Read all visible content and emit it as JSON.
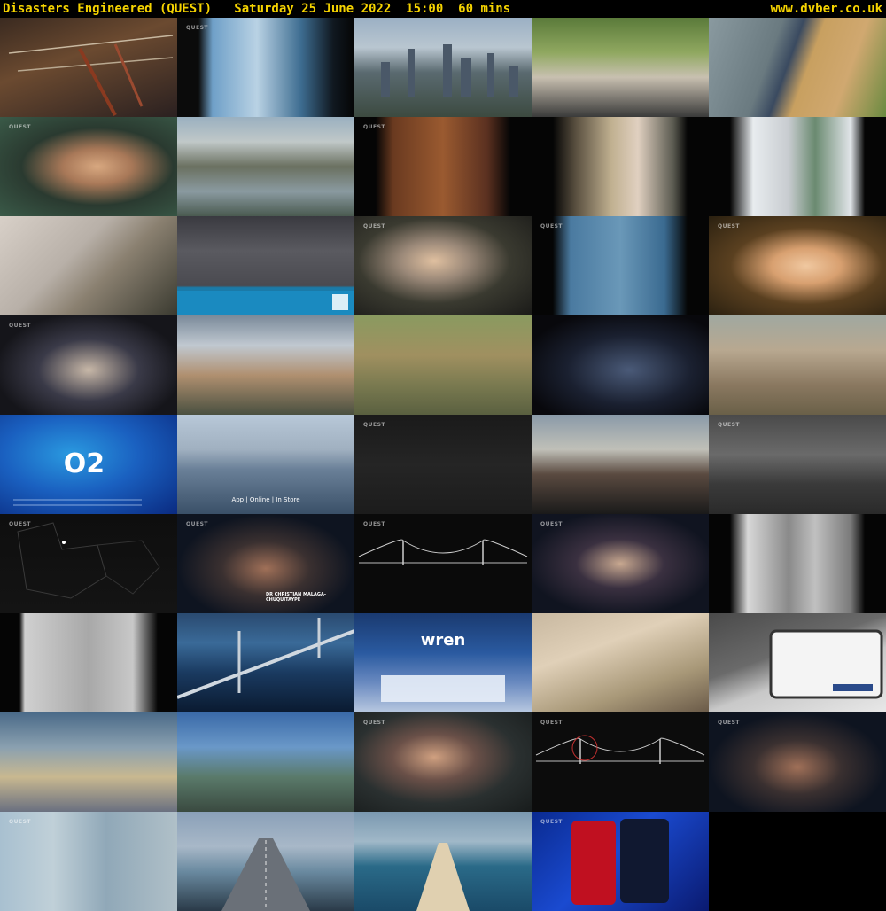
{
  "header": {
    "title": "Disasters Engineered (QUEST)   Saturday 25 June 2022  15:00  60 mins",
    "site": "www.dvber.co.uk"
  },
  "colors": {
    "header_text": "#f5d300",
    "background": "#000000"
  },
  "thumbnails": [
    {
      "id": 1,
      "label": "",
      "watermark": "",
      "bg": "linear-gradient(160deg,#3a2a20 0%,#6b4a30 40%,#2a2020 100%)",
      "overlay": "rods"
    },
    {
      "id": 2,
      "label": "",
      "watermark": "QUEST",
      "bg": "linear-gradient(90deg,#0b0b0b 0%,#0b0b0b 12%,#6fa0c8 20%,#b9d2e4 45%,#3d6c90 70%,#101820 88%,#050505 100%)"
    },
    {
      "id": 3,
      "label": "",
      "watermark": "",
      "bg": "linear-gradient(180deg,#9bb0c4 0%,#b9c6d0 30%,#5a6a70 55%,#3c4a40 100%)",
      "overlay": "city"
    },
    {
      "id": 4,
      "label": "",
      "watermark": "",
      "bg": "linear-gradient(180deg,#5a7a3a 0%,#90a860 35%,#c8c0b0 60%,#3a3a3a 100%)"
    },
    {
      "id": 5,
      "label": "",
      "watermark": "",
      "bg": "linear-gradient(110deg,#8a9aa0 0%,#6a7a80 35%,#3a4a60 45%,#c8a060 55%,#d0a870 75%,#6a8a40 100%)"
    },
    {
      "id": 6,
      "label": "",
      "watermark": "QUEST",
      "bg": "radial-gradient(ellipse at 55% 50%,#d8a880 0%,#a87858 25%,#2a3a30 55%,#3a5a48 100%)"
    },
    {
      "id": 7,
      "label": "",
      "watermark": "",
      "bg": "linear-gradient(180deg,#9ab0c0 0%,#c0c8c8 25%,#6a7060 50%,#8a9aa0 75%,#4a5a50 100%)"
    },
    {
      "id": 8,
      "label": "",
      "watermark": "QUEST",
      "bg": "linear-gradient(90deg,#050505 0%,#050505 12%,#6a3a20 22%,#9a5a30 50%,#5a3020 75%,#050505 88%,#050505 100%)"
    },
    {
      "id": 9,
      "label": "",
      "watermark": "",
      "bg": "linear-gradient(90deg,#050505 0%,#050505 12%,#5a5040 25%,#c0b090 45%,#e0d0c0 60%,#5a5a50 80%,#050505 88%)"
    },
    {
      "id": 10,
      "label": "",
      "watermark": "",
      "bg": "linear-gradient(90deg,#050505 0%,#050505 12%,#e8ecef 25%,#c8ccd0 45%,#6a8a70 60%,#e0e4e8 80%,#050505 88%)"
    },
    {
      "id": 11,
      "label": "",
      "watermark": "",
      "bg": "linear-gradient(135deg,#d8d0c8 0%,#b8b0a8 40%,#8a8070 60%,#3a3a30 100%)"
    },
    {
      "id": 12,
      "label": "",
      "watermark": "",
      "bg": "linear-gradient(180deg,#3a3a40 0%,#5a5a60 35%,#4a4a50 70%,#1a7aa8 72%,#1a7aa8 100%)",
      "overlay": "banner"
    },
    {
      "id": 13,
      "label": "",
      "watermark": "QUEST",
      "bg": "radial-gradient(ellipse at 45% 45%,#e0c0a0 0%,#9a8878 25%,#3a3a30 55%,#1a1a18 100%)"
    },
    {
      "id": 14,
      "label": "",
      "watermark": "QUEST",
      "bg": "linear-gradient(90deg,#050505 0%,#050505 12%,#4a7aa0 22%,#6a98b8 50%,#3a6a90 75%,#050505 88%,#050505 100%)"
    },
    {
      "id": 15,
      "label": "",
      "watermark": "QUEST",
      "bg": "radial-gradient(ellipse at 55% 50%,#f0c8a0 0%,#d8a070 25%,#5a4020 55%,#2a2010 100%)"
    },
    {
      "id": 16,
      "label": "",
      "watermark": "QUEST",
      "bg": "radial-gradient(ellipse at 50% 55%,#c8b8a8 0%,#3a3a48 40%,#15151a 75%)"
    },
    {
      "id": 17,
      "label": "",
      "watermark": "",
      "bg": "linear-gradient(180deg,#7a8a9a 0%,#c0c8d0 30%,#b09070 60%,#4a5040 100%)"
    },
    {
      "id": 18,
      "label": "",
      "watermark": "",
      "bg": "linear-gradient(180deg,#8a9a60 0%,#a09060 40%,#7a7a50 70%,#5a6040 100%)"
    },
    {
      "id": 19,
      "label": "",
      "watermark": "",
      "bg": "radial-gradient(ellipse at 55% 55%,#4a5a78 0%,#1a2030 45%,#08080c 80%)"
    },
    {
      "id": 20,
      "label": "",
      "watermark": "",
      "bg": "linear-gradient(180deg,#a0a8a0 0%,#b8a890 35%,#8a7860 70%,#6a6048 100%)"
    },
    {
      "id": 21,
      "label": "O2",
      "watermark": "",
      "bg": "radial-gradient(ellipse at 40% 40%,#2a9ae0 0%,#1a60c0 45%,#0a2a80 100%)",
      "overlay": "o2"
    },
    {
      "id": 22,
      "label": "App | Online | In Store",
      "watermark": "",
      "bg": "linear-gradient(180deg,#b8c8d8 0%,#a0b0c0 35%,#6a8098 55%,#3a5068 100%)"
    },
    {
      "id": 23,
      "label": "",
      "watermark": "QUEST",
      "bg": "linear-gradient(180deg,#1a1a1a 0%,#252525 50%,#1c1c1c 100%)"
    },
    {
      "id": 24,
      "label": "",
      "watermark": "",
      "bg": "linear-gradient(180deg,#8a9aa8 0%,#c0c0b8 35%,#5a4a40 60%,#1a1a1a 100%)"
    },
    {
      "id": 25,
      "label": "",
      "watermark": "QUEST",
      "bg": "linear-gradient(180deg,#4a4a4a 0%,#6a6a6a 40%,#3a3a3a 70%,#2a2a2a 100%)"
    },
    {
      "id": 26,
      "label": "",
      "watermark": "QUEST",
      "bg": "linear-gradient(180deg,#0e0e0e 0%,#141414 100%)",
      "overlay": "map"
    },
    {
      "id": 27,
      "label": "DR CHRISTIAN MALAGA-CHUQUITAYPE",
      "watermark": "QUEST",
      "bg": "radial-gradient(ellipse at 50% 55%,#a07058 0%,#3a3030 35%,#0e1420 70%)"
    },
    {
      "id": 28,
      "label": "",
      "watermark": "QUEST",
      "bg": "linear-gradient(180deg,#0a0a0a 0%,#0a0a0a 100%)",
      "overlay": "bridge"
    },
    {
      "id": 29,
      "label": "",
      "watermark": "QUEST",
      "bg": "radial-gradient(ellipse at 50% 50%,#c8a890 0%,#3a3040 35%,#101420 75%)"
    },
    {
      "id": 30,
      "label": "",
      "watermark": "",
      "bg": "linear-gradient(90deg,#050505 0%,#050505 12%,#d8d8d8 22%,#8a8a8a 45%,#c0c0c0 60%,#7a7a7a 80%,#050505 88%)"
    },
    {
      "id": 31,
      "label": "",
      "watermark": "",
      "bg": "linear-gradient(90deg,#050505 0%,#050505 11%,#d0d0d0 14%,#a8a8a8 50%,#c8c8c8 75%,#050505 89%,#050505 100%)"
    },
    {
      "id": 32,
      "label": "",
      "watermark": "",
      "bg": "linear-gradient(180deg,#2a4a70 0%,#3a6a98 30%,#1a3a60 60%,#0a1a30 100%)",
      "overlay": "suspension"
    },
    {
      "id": 33,
      "label": "wren",
      "watermark": "",
      "bg": "linear-gradient(180deg,#1a3a70 0%,#2a5aa0 40%,#6a8ac0 70%,#b8c8e0 100%)",
      "overlay": "wren"
    },
    {
      "id": 34,
      "label": "",
      "watermark": "",
      "bg": "linear-gradient(160deg,#c8b8a0 0%,#e0d0b8 35%,#a89878 70%,#6a5a48 100%)"
    },
    {
      "id": 35,
      "label": "",
      "watermark": "",
      "bg": "linear-gradient(160deg,#4a4a4a 0%,#6a6a6a 40%,#c8c8c8 60%,#e8e8e8 100%)",
      "overlay": "tablet"
    },
    {
      "id": 36,
      "label": "",
      "watermark": "",
      "bg": "linear-gradient(180deg,#4a6a88 0%,#8aa0b0 35%,#c8b890 65%,#6a7080 100%)"
    },
    {
      "id": 37,
      "label": "",
      "watermark": "",
      "bg": "linear-gradient(180deg,#3a6aa8 0%,#6a98c8 35%,#5a7a6a 65%,#3a4a40 100%)"
    },
    {
      "id": 38,
      "label": "",
      "watermark": "QUEST",
      "bg": "radial-gradient(ellipse at 45% 45%,#d0a080 0%,#6a5048 30%,#2a3030 60%,#181c1c 100%)"
    },
    {
      "id": 39,
      "label": "",
      "watermark": "QUEST",
      "bg": "linear-gradient(180deg,#0c0c0c 0%,#0c0c0c 100%)",
      "overlay": "bridge2"
    },
    {
      "id": 40,
      "label": "",
      "watermark": "QUEST",
      "bg": "radial-gradient(ellipse at 50% 55%,#a07058 0%,#3a3030 35%,#0e1420 70%)"
    },
    {
      "id": 41,
      "label": "",
      "watermark": "QUEST",
      "bg": "linear-gradient(90deg,#a8c0d0 0%,#c0d0d8 30%,#90a8b8 60%,#b0c0c8 100%)"
    },
    {
      "id": 42,
      "label": "",
      "watermark": "",
      "bg": "linear-gradient(180deg,#8aa0b8 0%,#a8b8c8 35%,#6a8aa0 60%,#2a3a48 100%)",
      "overlay": "road"
    },
    {
      "id": 43,
      "label": "",
      "watermark": "",
      "bg": "linear-gradient(180deg,#7a98b0 0%,#a0b8c8 30%,#2a6a88 55%,#1a4a68 100%)",
      "overlay": "sandbar"
    },
    {
      "id": 44,
      "label": "",
      "watermark": "QUEST",
      "bg": "linear-gradient(135deg,#0a2a90 0%,#1a4ad0 45%,#0a1a70 100%)",
      "overlay": "chase"
    }
  ]
}
